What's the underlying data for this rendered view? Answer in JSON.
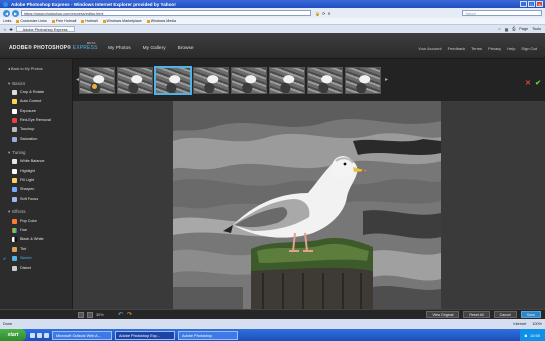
{
  "browser": {
    "title": "Adobe Photoshop Express - Windows Internet Explorer provided by Yahoo!",
    "url": "https://www.photoshop.com/express/editor.html",
    "search_placeholder": "Yahoo!",
    "links": [
      "Links",
      "Customize Links",
      "Free Hotmail",
      "Hotmail",
      "Windows Marketplace",
      "Windows Media"
    ],
    "tab_label": "Adobe Photoshop Express",
    "tools": [
      "Page",
      "Tools"
    ],
    "status_left": "Done",
    "status_right": [
      "Internet",
      "100%"
    ]
  },
  "app": {
    "brand": "ADOBE® PHOTOSHOP®",
    "brand_suffix": "EXPRESS",
    "beta": "BETA",
    "nav": [
      "My Photos",
      "My Gallery",
      "Browse"
    ],
    "right_nav": [
      "Your Account",
      "Feedback",
      "Terms",
      "Privacy",
      "Help",
      "Sign Out"
    ]
  },
  "left_panel": {
    "back": "Back to My Photos",
    "groups": [
      {
        "label": "Basics",
        "items": [
          "Crop & Rotate",
          "Auto Correct",
          "Exposure",
          "Red-Eye Removal",
          "Touchup",
          "Saturation"
        ]
      },
      {
        "label": "Tuning",
        "items": [
          "White Balance",
          "Highlight",
          "Fill Light",
          "Sharpen",
          "Soft Focus"
        ]
      },
      {
        "label": "Effects",
        "items": [
          "Pop Color",
          "Hue",
          "Black & White",
          "Tint",
          "Sketch",
          "Distort"
        ]
      }
    ],
    "active_tool": "Sketch"
  },
  "filmstrip": {
    "count": 8,
    "selected_index": 2
  },
  "bottom_bar": {
    "zoom": "30%",
    "buttons": [
      "View Original",
      "Reset All",
      "Cancel",
      "Save"
    ]
  },
  "taskbar": {
    "start": "start",
    "tasks": [
      "Microsoft Outlook Web A...",
      "Adobe Photoshop Exp...",
      "Adobe Photoshop"
    ],
    "clock": "10:55"
  },
  "colors": {
    "accent": "#4fb3e8",
    "save": "#2f85c8",
    "cancel_x": "#e84040",
    "accept": "#66cc44"
  }
}
